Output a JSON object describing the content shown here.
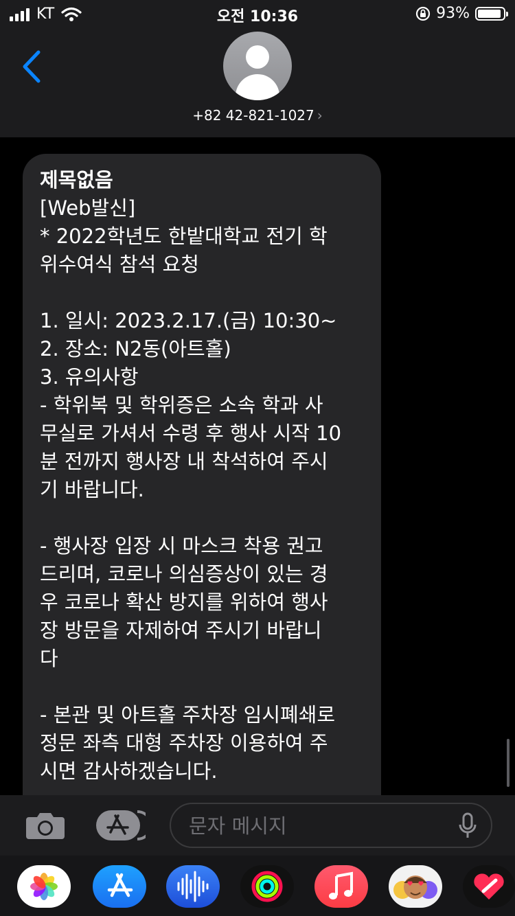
{
  "status_bar": {
    "carrier": "KT",
    "time": "오전 10:36",
    "battery": "93%",
    "battery_level": 0.93
  },
  "header": {
    "back_icon": "chevron-left-icon",
    "contact": "+82 42-821-1027",
    "chevron": "›"
  },
  "message": {
    "title": "제목없음",
    "body": "[Web발신]\n* 2022학년도 한밭대학교 전기 학\n위수여식 참석 요청\n\n1. 일시: 2023.2.17.(금) 10:30~\n2. 장소: N2동(아트홀)\n3. 유의사항\n- 학위복 및 학위증은 소속 학과 사\n무실로 가셔서 수령 후 행사 시작 10\n분 전까지 행사장 내 착석하여 주시\n기 바랍니다.\n\n- 행사장 입장 시 마스크 착용 권고\n드리며, 코로나 의심증상이 있는 경\n우 코로나 확산 방지를 위하여 행사\n장 방문을 자제하여 주시기 바랍니\n다\n\n- 본관 및 아트홀 주차장 임시폐쇄로\n정문 좌측 대형 주차장 이용하여 주\n시면 감사하겠습니다."
  },
  "input_bar": {
    "placeholder": "문자 메시지"
  },
  "app_strip": {
    "apps": [
      "photos-app-icon",
      "app-store-icon",
      "audio-messages-icon",
      "fitness-icon",
      "music-icon",
      "memoji-icon",
      "digital-touch-icon"
    ]
  },
  "colors": {
    "accent": "#0a84ff",
    "bubble": "#262628",
    "header": "#1c1c1e"
  }
}
